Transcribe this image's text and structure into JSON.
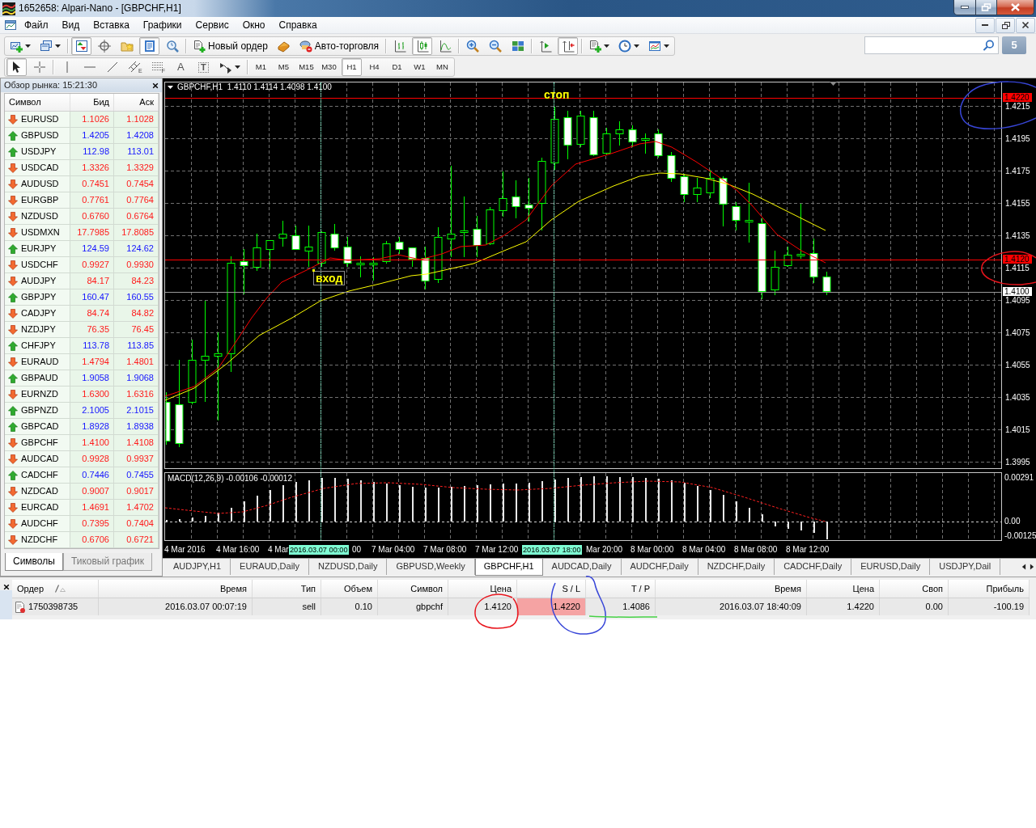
{
  "window": {
    "title": "1652658: Alpari-Nano - [GBPCHF,H1]"
  },
  "menu": [
    {
      "label": "Файл"
    },
    {
      "label": "Вид"
    },
    {
      "label": "Вставка"
    },
    {
      "label": "Графики"
    },
    {
      "label": "Сервис"
    },
    {
      "label": "Окно"
    },
    {
      "label": "Справка"
    }
  ],
  "toolbar": {
    "groups": [
      [
        {
          "kind": "new-chart",
          "dropdown": true,
          "pressed": false
        },
        {
          "kind": "profiles",
          "dropdown": true,
          "pressed": false
        }
      ],
      [
        {
          "kind": "market-watch",
          "dropdown": false,
          "pressed": true
        },
        {
          "kind": "data-window",
          "dropdown": false,
          "pressed": false
        },
        {
          "kind": "navigator",
          "dropdown": false,
          "pressed": false
        },
        {
          "kind": "terminal",
          "dropdown": false,
          "pressed": true
        },
        {
          "kind": "tester",
          "dropdown": false,
          "pressed": false
        }
      ],
      [
        {
          "kind": "new-order",
          "label": "Новый ордер",
          "dropdown": false,
          "pressed": false
        },
        {
          "kind": "editor",
          "dropdown": false,
          "pressed": false
        },
        {
          "kind": "autotrading",
          "label": "Авто-торговля",
          "dropdown": false,
          "pressed": false
        }
      ],
      [
        {
          "kind": "bar-chart",
          "dropdown": false,
          "pressed": false
        },
        {
          "kind": "candle-chart",
          "dropdown": false,
          "pressed": true
        },
        {
          "kind": "line-chart",
          "dropdown": false,
          "pressed": false
        }
      ],
      [
        {
          "kind": "zoom-in",
          "dropdown": false,
          "pressed": false
        },
        {
          "kind": "zoom-out",
          "dropdown": false,
          "pressed": false
        },
        {
          "kind": "tile",
          "dropdown": false,
          "pressed": false
        }
      ],
      [
        {
          "kind": "auto-scroll",
          "dropdown": false,
          "pressed": false
        },
        {
          "kind": "chart-shift",
          "dropdown": false,
          "pressed": true
        }
      ],
      [
        {
          "kind": "indicators",
          "dropdown": true,
          "pressed": false
        },
        {
          "kind": "periods",
          "dropdown": true,
          "pressed": false
        },
        {
          "kind": "templates",
          "dropdown": true,
          "pressed": false
        }
      ]
    ]
  },
  "messages": {
    "count": "5"
  },
  "drawing_toolbar": {
    "groups": [
      [
        {
          "kind": "cursor",
          "dropdown": false,
          "pressed": true
        },
        {
          "kind": "crosshair",
          "dropdown": false,
          "pressed": false
        }
      ],
      [
        {
          "kind": "vertical-line",
          "dropdown": false,
          "pressed": false
        },
        {
          "kind": "horizontal-line",
          "dropdown": false,
          "pressed": false
        },
        {
          "kind": "trendline",
          "dropdown": false,
          "pressed": false
        },
        {
          "kind": "channel",
          "glyph": "E",
          "dropdown": false,
          "pressed": false
        },
        {
          "kind": "fibonacci",
          "glyph": "F",
          "dropdown": false,
          "pressed": false
        },
        {
          "kind": "text",
          "glyph": "A",
          "dropdown": false,
          "pressed": false
        },
        {
          "kind": "label",
          "glyph": "T",
          "dropdown": false,
          "pressed": false
        },
        {
          "kind": "arrows",
          "dropdown": true,
          "pressed": false
        }
      ]
    ]
  },
  "timeframes": [
    {
      "label": "M1",
      "selected": false
    },
    {
      "label": "M5",
      "selected": false
    },
    {
      "label": "M15",
      "selected": false
    },
    {
      "label": "M30",
      "selected": false
    },
    {
      "label": "H1",
      "selected": true
    },
    {
      "label": "H4",
      "selected": false
    },
    {
      "label": "D1",
      "selected": false
    },
    {
      "label": "W1",
      "selected": false
    },
    {
      "label": "MN",
      "selected": false
    }
  ],
  "market_watch": {
    "title": "Обзор рынка: 15:21:30",
    "columns": [
      "Символ",
      "Бид",
      "Аск"
    ],
    "rows": [
      {
        "symbol": "EURUSD",
        "bid": "1.1026",
        "ask": "1.1028",
        "rising": false
      },
      {
        "symbol": "GBPUSD",
        "bid": "1.4205",
        "ask": "1.4208",
        "rising": true
      },
      {
        "symbol": "USDJPY",
        "bid": "112.98",
        "ask": "113.01",
        "rising": true
      },
      {
        "symbol": "USDCAD",
        "bid": "1.3326",
        "ask": "1.3329",
        "rising": false
      },
      {
        "symbol": "AUDUSD",
        "bid": "0.7451",
        "ask": "0.7454",
        "rising": false
      },
      {
        "symbol": "EURGBP",
        "bid": "0.7761",
        "ask": "0.7764",
        "rising": false
      },
      {
        "symbol": "NZDUSD",
        "bid": "0.6760",
        "ask": "0.6764",
        "rising": false
      },
      {
        "symbol": "USDMXN",
        "bid": "17.7985",
        "ask": "17.8085",
        "rising": false
      },
      {
        "symbol": "EURJPY",
        "bid": "124.59",
        "ask": "124.62",
        "rising": true
      },
      {
        "symbol": "USDCHF",
        "bid": "0.9927",
        "ask": "0.9930",
        "rising": false
      },
      {
        "symbol": "AUDJPY",
        "bid": "84.17",
        "ask": "84.23",
        "rising": false
      },
      {
        "symbol": "GBPJPY",
        "bid": "160.47",
        "ask": "160.55",
        "rising": true
      },
      {
        "symbol": "CADJPY",
        "bid": "84.74",
        "ask": "84.82",
        "rising": false
      },
      {
        "symbol": "NZDJPY",
        "bid": "76.35",
        "ask": "76.45",
        "rising": false
      },
      {
        "symbol": "CHFJPY",
        "bid": "113.78",
        "ask": "113.85",
        "rising": true
      },
      {
        "symbol": "EURAUD",
        "bid": "1.4794",
        "ask": "1.4801",
        "rising": false
      },
      {
        "symbol": "GBPAUD",
        "bid": "1.9058",
        "ask": "1.9068",
        "rising": true
      },
      {
        "symbol": "EURNZD",
        "bid": "1.6300",
        "ask": "1.6316",
        "rising": false
      },
      {
        "symbol": "GBPNZD",
        "bid": "2.1005",
        "ask": "2.1015",
        "rising": true
      },
      {
        "symbol": "GBPCAD",
        "bid": "1.8928",
        "ask": "1.8938",
        "rising": true
      },
      {
        "symbol": "GBPCHF",
        "bid": "1.4100",
        "ask": "1.4108",
        "rising": false
      },
      {
        "symbol": "AUDCAD",
        "bid": "0.9928",
        "ask": "0.9937",
        "rising": false
      },
      {
        "symbol": "CADCHF",
        "bid": "0.7446",
        "ask": "0.7455",
        "rising": true
      },
      {
        "symbol": "NZDCAD",
        "bid": "0.9007",
        "ask": "0.9017",
        "rising": false
      },
      {
        "symbol": "EURCAD",
        "bid": "1.4691",
        "ask": "1.4702",
        "rising": false
      },
      {
        "symbol": "AUDCHF",
        "bid": "0.7395",
        "ask": "0.7404",
        "rising": false
      },
      {
        "symbol": "NZDCHF",
        "bid": "0.6706",
        "ask": "0.6721",
        "rising": false
      }
    ],
    "tabs": [
      {
        "label": "Символы",
        "selected": true
      },
      {
        "label": "Тиковый график",
        "selected": false
      }
    ]
  },
  "chart": {
    "header": "GBPCHF,H1  1.4110 1.4114 1.4098 1.4100",
    "annotations": [
      {
        "text": "стоп",
        "selected": false
      },
      {
        "text": "вход",
        "selected": true
      }
    ],
    "price_labels": [
      "1.4215",
      "1.4195",
      "1.4175",
      "1.4155",
      "1.4135",
      "1.4115",
      "1.4095",
      "1.4075",
      "1.4055",
      "1.4035",
      "1.4015",
      "1.3995"
    ],
    "levels": [
      {
        "price": "1.4220",
        "kind": "order"
      },
      {
        "price": "1.4120",
        "kind": "order"
      },
      {
        "price": "1.4100",
        "kind": "bid"
      }
    ],
    "indicator": {
      "label": "MACD(12,26,9) -0.00106 -0.00012",
      "scale": [
        "0.00291",
        "0.00",
        "-0.00125"
      ]
    },
    "time_labels": [
      {
        "text": "4 Mar 2016",
        "kind": "tick"
      },
      {
        "text": "4 Mar 16:00",
        "kind": "tick"
      },
      {
        "text": "4 Mar",
        "kind": "tick"
      },
      {
        "text": "2016.03.07 00:00",
        "kind": "cursor"
      },
      {
        "text": "00",
        "kind": "tick"
      },
      {
        "text": "7 Mar 04:00",
        "kind": "tick"
      },
      {
        "text": "7 Mar 08:00",
        "kind": "tick"
      },
      {
        "text": "7 Mar 12:00",
        "kind": "tick"
      },
      {
        "text": "2016.03.07 18:00",
        "kind": "cursor"
      },
      {
        "text": "Mar 20:00",
        "kind": "tick"
      },
      {
        "text": "8 Mar 00:00",
        "kind": "tick"
      },
      {
        "text": "8 Mar 04:00",
        "kind": "tick"
      },
      {
        "text": "8 Mar 08:00",
        "kind": "tick"
      },
      {
        "text": "8 Mar 12:00",
        "kind": "tick"
      }
    ]
  },
  "chart_tabs": [
    {
      "label": "AUDJPY,H1",
      "selected": false
    },
    {
      "label": "EURAUD,Daily",
      "selected": false
    },
    {
      "label": "NZDUSD,Daily",
      "selected": false
    },
    {
      "label": "GBPUSD,Weekly",
      "selected": false
    },
    {
      "label": "GBPCHF,H1",
      "selected": true
    },
    {
      "label": "AUDCAD,Daily",
      "selected": false
    },
    {
      "label": "AUDCHF,Daily",
      "selected": false
    },
    {
      "label": "NZDCHF,Daily",
      "selected": false
    },
    {
      "label": "CADCHF,Daily",
      "selected": false
    },
    {
      "label": "EURUSD,Daily",
      "selected": false
    },
    {
      "label": "USDJPY,Dail",
      "selected": false
    }
  ],
  "terminal": {
    "columns": [
      {
        "label": "Ордер",
        "sorted": true
      },
      {
        "label": "Время",
        "sorted": false
      },
      {
        "label": "Тип",
        "sorted": false
      },
      {
        "label": "Объем",
        "sorted": false
      },
      {
        "label": "Символ",
        "sorted": false
      },
      {
        "label": "Цена",
        "sorted": false
      },
      {
        "label": "S / L",
        "sorted": false
      },
      {
        "label": "T / P",
        "sorted": false
      },
      {
        "label": "Время",
        "sorted": false
      },
      {
        "label": "Цена",
        "sorted": false
      },
      {
        "label": "Своп",
        "sorted": false
      },
      {
        "label": "Прибыль",
        "sorted": false
      }
    ],
    "rows": [
      {
        "cells": [
          {
            "text": "1750398735",
            "alert": false
          },
          {
            "text": "2016.03.07 00:07:19",
            "alert": false
          },
          {
            "text": "sell",
            "alert": false
          },
          {
            "text": "0.10",
            "alert": false
          },
          {
            "text": "gbpchf",
            "alert": false
          },
          {
            "text": "1.4120",
            "alert": false
          },
          {
            "text": "1.4220",
            "alert": true
          },
          {
            "text": "1.4086",
            "alert": false
          },
          {
            "text": "2016.03.07 18:40:09",
            "alert": false
          },
          {
            "text": "1.4220",
            "alert": false
          },
          {
            "text": "0.00",
            "alert": false
          },
          {
            "text": "-100.19",
            "alert": false
          }
        ]
      }
    ]
  }
}
